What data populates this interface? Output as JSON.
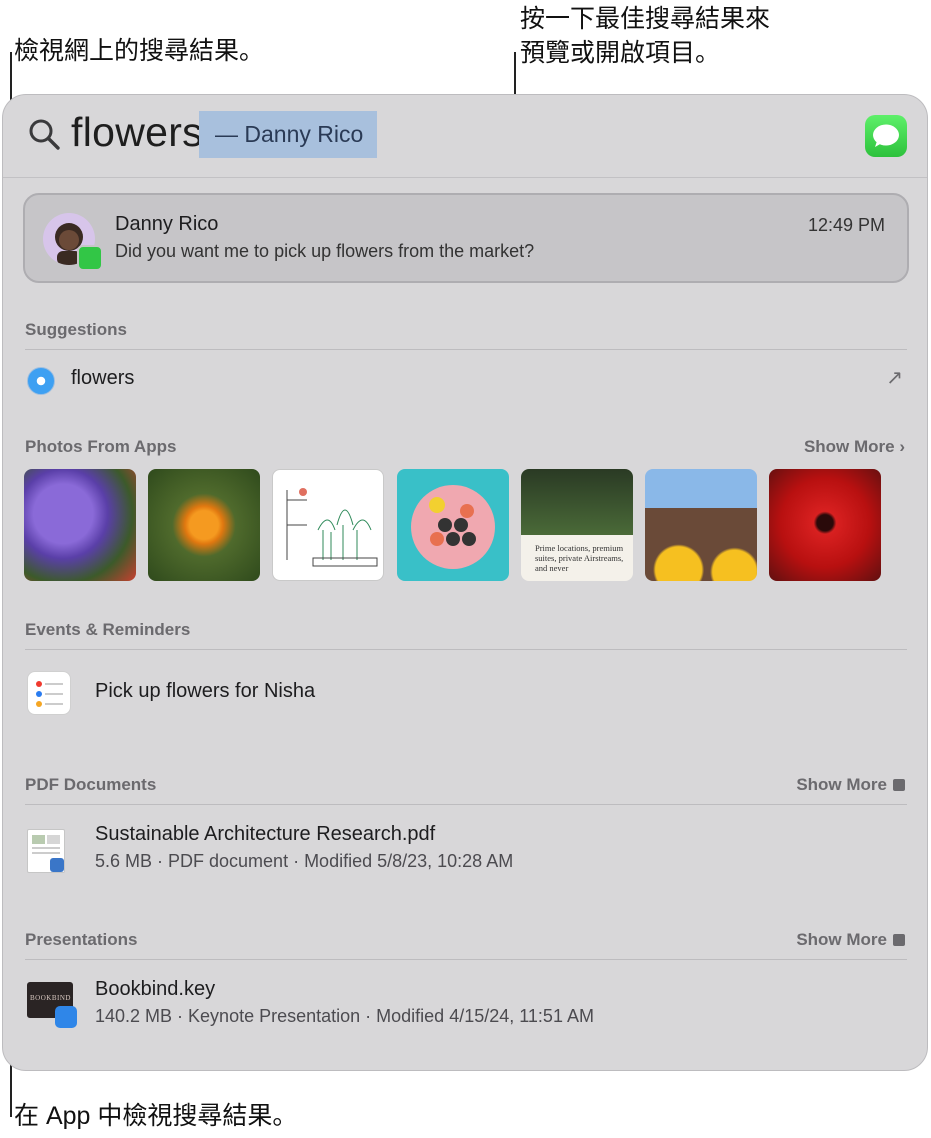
{
  "callouts": {
    "web_results": "檢視網上的搜尋結果。",
    "top_hit_line1": "按一下最佳搜尋結果來",
    "top_hit_line2": "預覽或開啟項目。",
    "in_app": "在 App 中檢視搜尋結果。"
  },
  "search": {
    "query": "flowers",
    "completion": "—  Danny Rico",
    "icon": "search-icon"
  },
  "top_hit": {
    "name": "Danny Rico",
    "message": "Did you want me to pick up flowers from the market?",
    "time": "12:49 PM",
    "app_icon": "messages-icon"
  },
  "sections": {
    "suggestions": {
      "title": "Suggestions",
      "item_label": "flowers",
      "item_icon": "safari-icon",
      "item_action": "↗"
    },
    "photos": {
      "title": "Photos From Apps",
      "show_more": "Show More ›",
      "thumbnails": [
        "purple-iris-photo",
        "orange-marigold-photo",
        "plant-sketch-photo",
        "sushi-platter-photo",
        "garden-article-photo",
        "sunflower-friends-photo",
        "red-gerbera-photo"
      ],
      "article_text": "Prime locations, premium suites, private Airstreams, and never"
    },
    "events": {
      "title": "Events & Reminders",
      "item_title": "Pick up flowers for Nisha",
      "item_icon": "reminders-icon"
    },
    "pdf": {
      "title": "PDF Documents",
      "show_more": "Show More",
      "item_title": "Sustainable Architecture Research.pdf",
      "item_meta": "5.6 MB · PDF document · Modified 5/8/23, 10:28 AM",
      "item_icon": "pdf-document-icon"
    },
    "presentations": {
      "title": "Presentations",
      "show_more": "Show More",
      "item_title": "Bookbind.key",
      "item_meta": "140.2 MB · Keynote Presentation · Modified 4/15/24, 11:51 AM",
      "item_icon": "keynote-icon",
      "thumb_text": "BOOKBIND"
    }
  },
  "colors": {
    "panel_bg": "#d8d7d9",
    "completion_highlight": "#a8c0dd",
    "messages_green": "#32c646"
  }
}
